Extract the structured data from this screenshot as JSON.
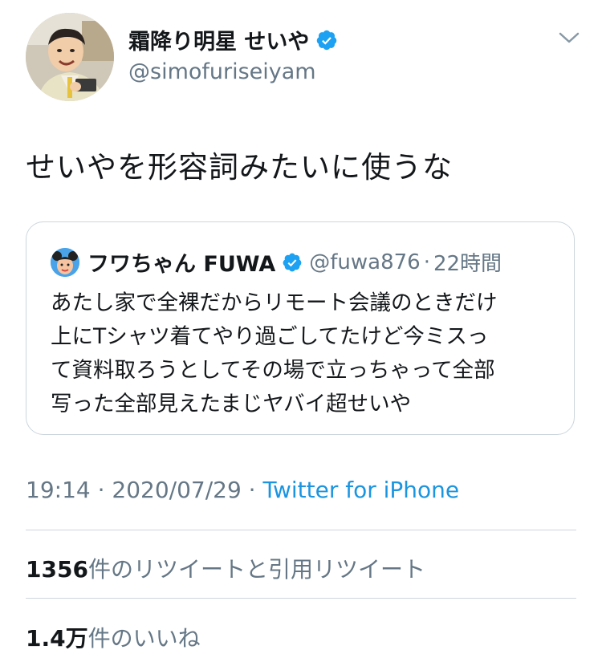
{
  "author": {
    "display_name": "霜降り明星 せいや",
    "handle": "@simofuriseiyam"
  },
  "tweet": {
    "text": "せいやを形容詞みたいに使うな",
    "timestamp": "19:14 · 2020/07/29 · ",
    "source": "Twitter for iPhone"
  },
  "quoted": {
    "display_name": "フワちゃん FUWA",
    "handle": "@fuwa876",
    "separator": "·",
    "time": "22時間",
    "lines": [
      "あたし家で全裸だからリモート会議のときだけ",
      "上にTシャツ着てやり過ごしてたけど今ミスっ",
      "て資料取ろうとしてその場で立っちゃって全部",
      "写った全部見えたまじヤバイ超せいや"
    ]
  },
  "stats": {
    "retweets_count": "1356",
    "retweets_label": "件のリツイートと引用リツイート",
    "likes_count": "1.4万",
    "likes_label": "件のいいね"
  },
  "colors": {
    "text": "#14171a",
    "secondary": "#657786",
    "link": "#1b95e0",
    "verified": "#1da1f2",
    "border": "#ccd6dd"
  },
  "icons": {
    "verified": "verified-badge-icon",
    "more": "chevron-down-icon"
  }
}
